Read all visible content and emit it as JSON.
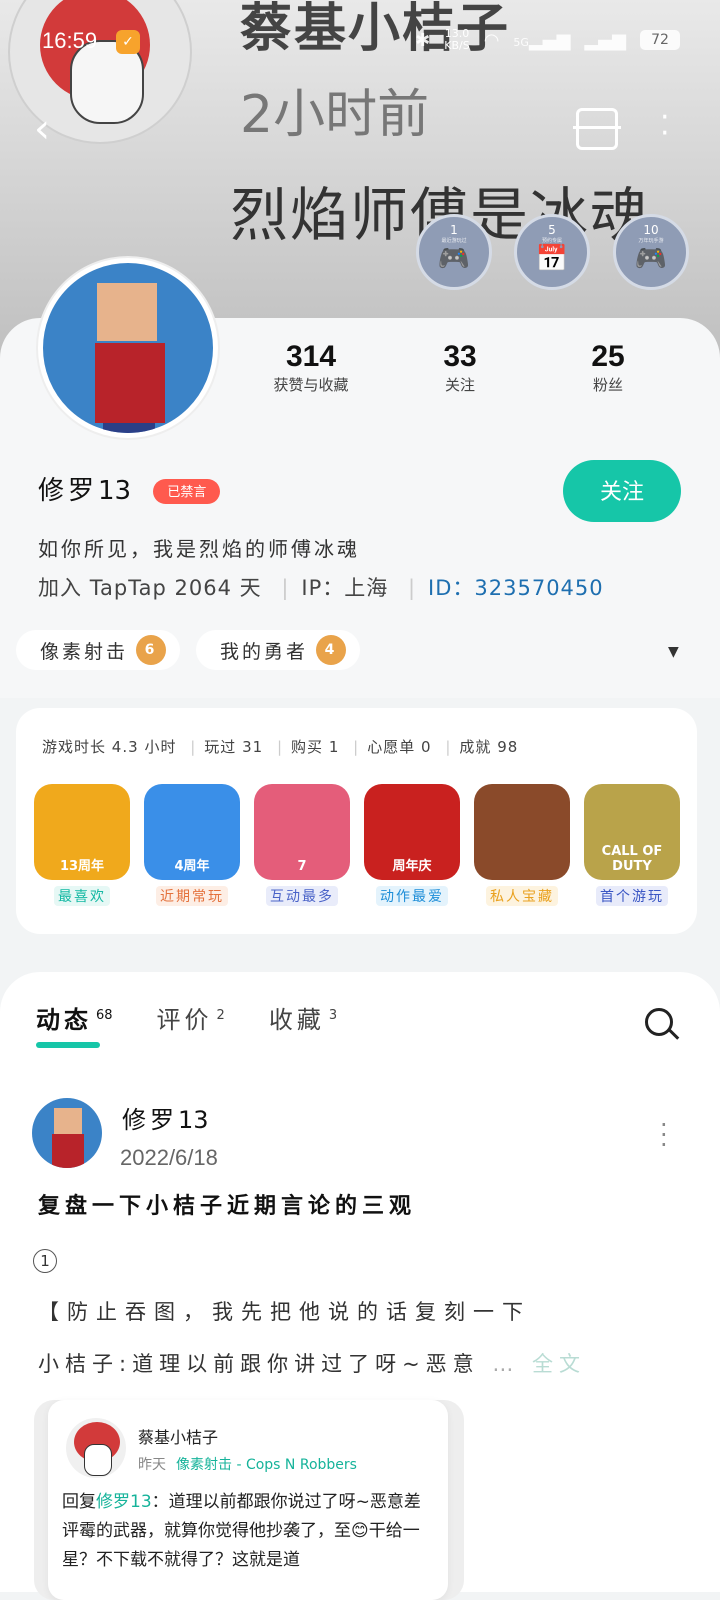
{
  "status_bar": {
    "time": "16:59",
    "speed_value": "13.0",
    "speed_unit": "KB/S",
    "network": "5G",
    "battery": "72"
  },
  "hero": {
    "title": "蔡基小桔子",
    "subtitle": "2小时前",
    "quote": "烈焰师傅是冰魂"
  },
  "badges": [
    {
      "num": "1",
      "text": "最近游玩过"
    },
    {
      "num": "5",
      "text": "预约专属"
    },
    {
      "num": "10",
      "text": "万年玩手游"
    }
  ],
  "stats": {
    "likes_value": "314",
    "likes_label": "获赞与收藏",
    "following_value": "33",
    "following_label": "关注",
    "fans_value": "25",
    "fans_label": "粉丝"
  },
  "profile": {
    "name_cn": "修罗",
    "name_num": "13",
    "muted_label": "已禁言",
    "follow_label": "关注",
    "bio": "如你所见，我是烈焰的师傅冰魂",
    "joined_prefix": "加入",
    "joined_app": "TapTap",
    "joined_days": "2064",
    "joined_suffix": "天",
    "ip_label": "IP：",
    "ip_value": "上海",
    "id_label": "ID：",
    "id_value": "323570450"
  },
  "tags": [
    {
      "label": "像素射击",
      "level": "6"
    },
    {
      "label": "我的勇者",
      "level": "4"
    }
  ],
  "game_stats": {
    "playtime_label": "游戏时长",
    "playtime_value": "4.3",
    "playtime_unit": "小时",
    "played_label": "玩过",
    "played_value": "31",
    "bought_label": "购买",
    "bought_value": "1",
    "wishlist_label": "心愿单",
    "wishlist_value": "0",
    "achievements_label": "成就",
    "achievements_value": "98"
  },
  "games": [
    {
      "label": "最喜欢",
      "icon_text": "13周年",
      "color": "#f0a91c",
      "label_color": "#13b8a3",
      "label_bg": "#e6f8f5"
    },
    {
      "label": "近期常玩",
      "icon_text": "4周年",
      "color": "#3a8fe8",
      "label_color": "#e4713c",
      "label_bg": "#fdeee5"
    },
    {
      "label": "互动最多",
      "icon_text": "7",
      "color": "#e45d7a",
      "label_color": "#4a63c8",
      "label_bg": "#e9ecfa"
    },
    {
      "label": "动作最爱",
      "icon_text": "周年庆",
      "color": "#c9211f",
      "label_color": "#1e8ed8",
      "label_bg": "#e4f3fc"
    },
    {
      "label": "私人宝藏",
      "icon_text": "",
      "color": "#8a4a2a",
      "label_color": "#e9a11f",
      "label_bg": "#fdf3df"
    },
    {
      "label": "首个游玩",
      "icon_text": "CALL OF DUTY",
      "color": "#b9a34a",
      "label_color": "#3a56c4",
      "label_bg": "#e8ebfa"
    }
  ],
  "tabs": [
    {
      "label": "动态",
      "count": "68"
    },
    {
      "label": "评价",
      "count": "2"
    },
    {
      "label": "收藏",
      "count": "3"
    }
  ],
  "post": {
    "author_cn": "修罗",
    "author_num": "13",
    "date": "2022/6/18",
    "title": "复盘一下小桔子近期言论的三观",
    "marker": "1",
    "line1": "【防止吞图，我先把他说的话复刻一下",
    "line2_main": "小桔子:道理以前跟你讲过了呀~恶意",
    "ellipsis": "…",
    "full_text": "全文"
  },
  "quote_card": {
    "author": "蔡基小桔子",
    "time": "昨天",
    "game": "像素射击 - Cops N Robbers",
    "reply_prefix": "回复",
    "reply_to": "修罗13",
    "text": "：道理以前都跟你说过了呀~恶意差评霉的武器，就算你觉得他抄袭了，至😊干给一星？不下载不就得了？这就是道"
  }
}
